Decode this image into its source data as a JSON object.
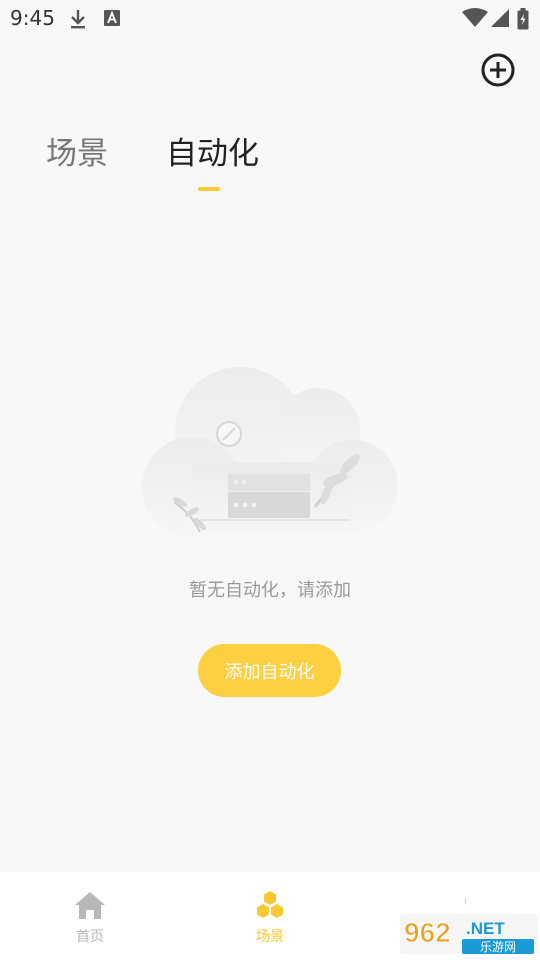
{
  "statusbar": {
    "time": "9:45"
  },
  "tabs": {
    "scene": "场景",
    "automation": "自动化"
  },
  "empty": {
    "message": "暂无自动化，请添加"
  },
  "actions": {
    "add_automation": "添加自动化"
  },
  "bottom_nav": [
    {
      "label": "首页",
      "icon": "home-icon"
    },
    {
      "label": "场景",
      "icon": "honeycomb-icon"
    },
    {
      "label": "",
      "icon": "profile-icon"
    }
  ],
  "watermark": {
    "number": "962",
    "suffix": ".NET",
    "site": "乐游网"
  },
  "colors": {
    "accent": "#fcd040",
    "tab_underline": "#f9c933",
    "inactive": "#b8b8b8",
    "background": "#f8f8f8"
  }
}
